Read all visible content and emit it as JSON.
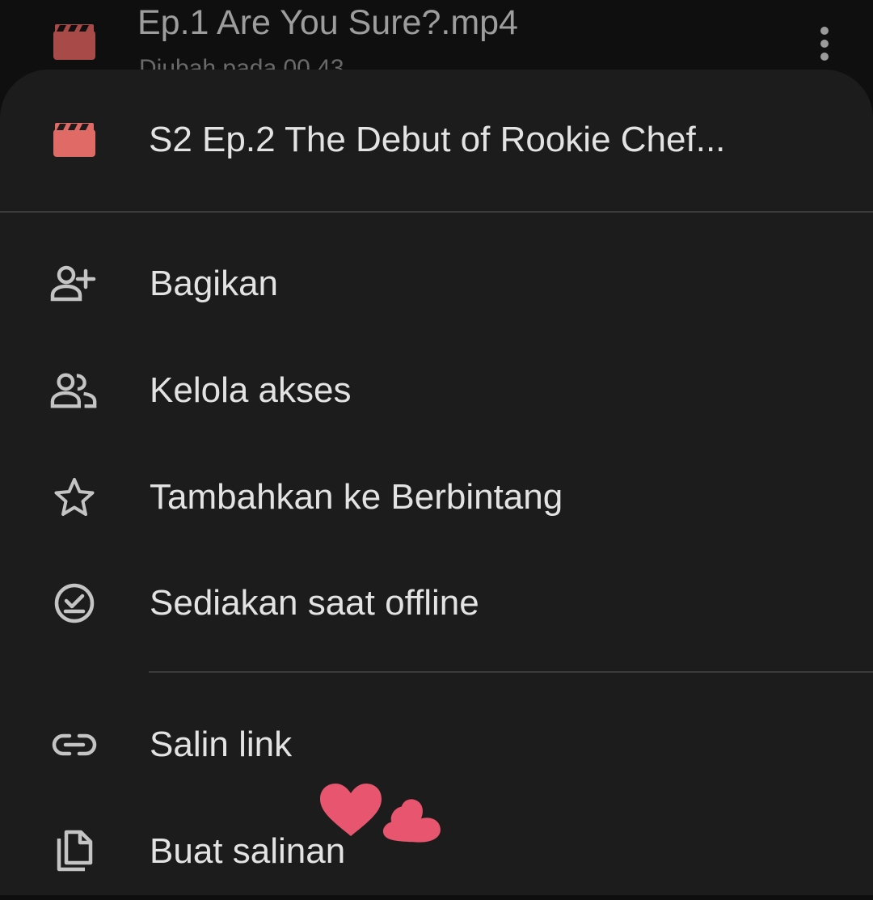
{
  "background_row": {
    "title": "Ep.1 Are You Sure?.mp4",
    "subtitle": "Diubah pada 00.43",
    "file_icon": "video-clapper-icon",
    "more_icon": "more-vert-icon"
  },
  "sheet": {
    "file_title": "S2 Ep.2 The Debut of Rookie Chef...",
    "file_icon": "video-clapper-icon",
    "items": [
      {
        "label": "Bagikan",
        "icon": "person-add-icon"
      },
      {
        "label": "Kelola akses",
        "icon": "people-icon"
      },
      {
        "label": "Tambahkan ke Berbintang",
        "icon": "star-outline-icon"
      },
      {
        "label": "Sediakan saat offline",
        "icon": "offline-check-icon"
      },
      {
        "label": "Salin link",
        "icon": "link-icon"
      },
      {
        "label": "Buat salinan",
        "icon": "copy-icon"
      }
    ]
  },
  "colors": {
    "sheet_bg": "#1c1c1c",
    "text": "#e3e3e3",
    "icon": "#c4c4c4",
    "file_icon": "#e06a66",
    "heart": "#e8556e"
  },
  "decoration": {
    "icon": "hearts-sticker"
  }
}
